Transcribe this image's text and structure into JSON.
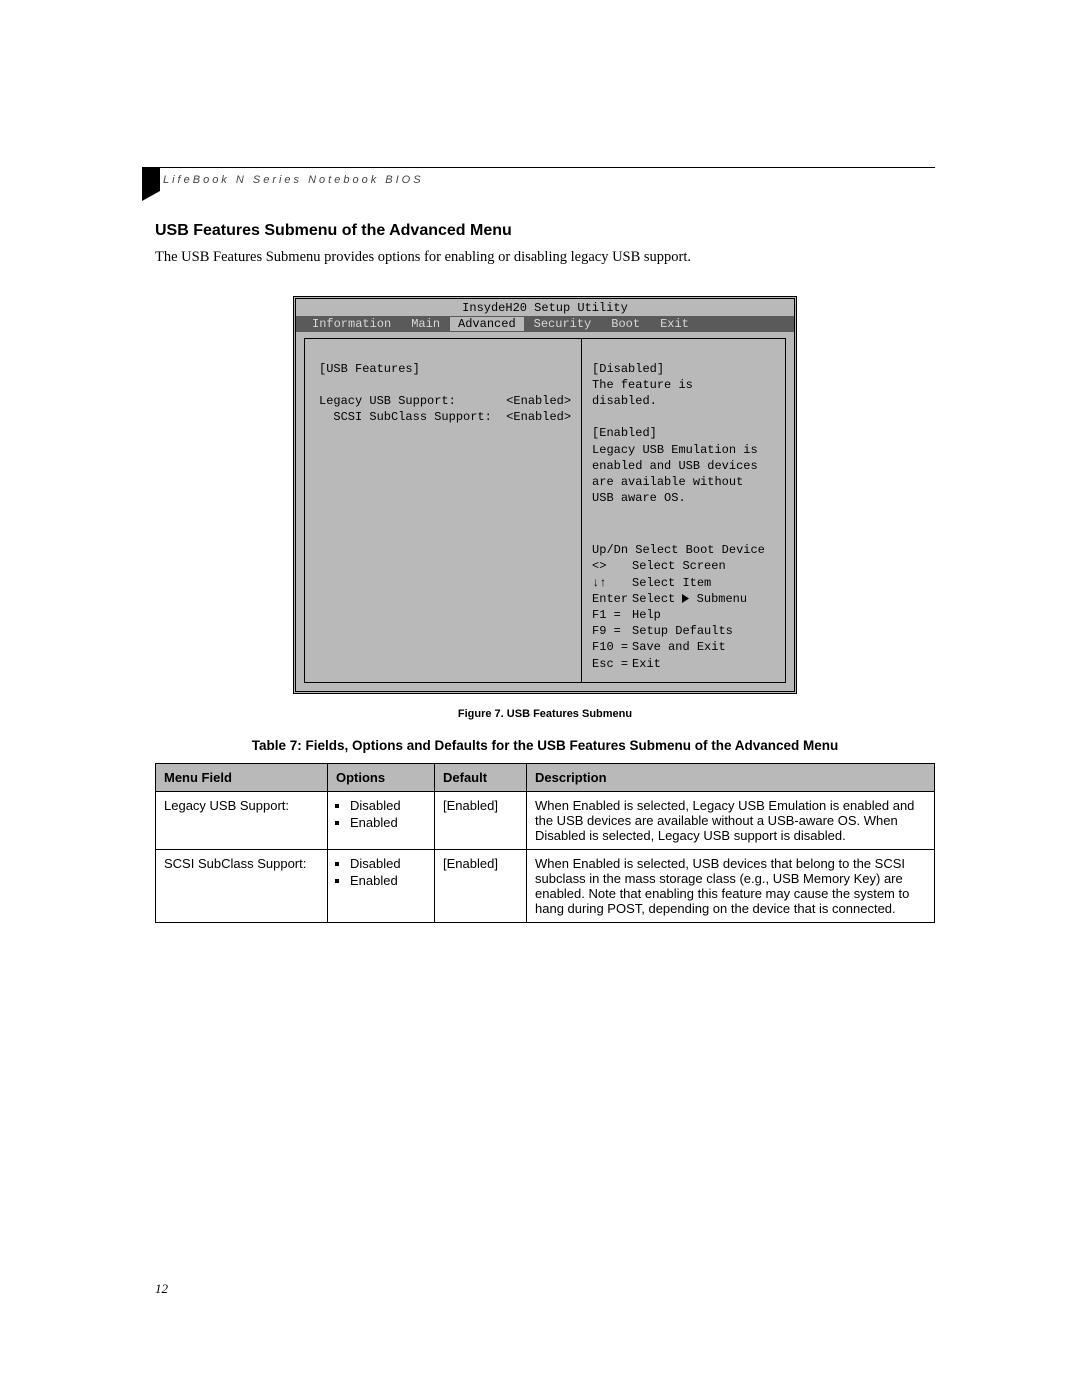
{
  "running_head": "LifeBook N Series Notebook BIOS",
  "section_title": "USB Features Submenu of the Advanced Menu",
  "intro_text": "The USB Features Submenu provides options for enabling or disabling legacy USB support.",
  "bios": {
    "utility_title": "InsydeH20 Setup Utility",
    "menu": {
      "items": [
        "Information",
        "Main",
        "Advanced",
        "Security",
        "Boot",
        "Exit"
      ],
      "selected_index": 2
    },
    "left_panel": {
      "heading": "[USB Features]",
      "rows": [
        {
          "label": "Legacy USB Support:",
          "value": "<Enabled>",
          "indent": 0
        },
        {
          "label": "SCSI SubClass Support:",
          "value": "<Enabled>",
          "indent": 1
        }
      ]
    },
    "right_panel": {
      "description": [
        "[Disabled]",
        "The feature is",
        "disabled.",
        "",
        "[Enabled]",
        "Legacy USB Emulation is",
        "enabled and USB devices",
        "are available without",
        "USB aware OS."
      ],
      "help": [
        {
          "key": "Up/Dn",
          "text": "Select Boot Device",
          "single": true
        },
        {
          "key": "<>",
          "text": "Select Screen"
        },
        {
          "key": "↓↑",
          "text": "Select Item"
        },
        {
          "key": "Enter",
          "text": "Select  Submenu",
          "triangle": true
        },
        {
          "key": "F1  =",
          "text": "Help"
        },
        {
          "key": "F9  =",
          "text": "Setup Defaults"
        },
        {
          "key": "F10 =",
          "text": "Save and Exit"
        },
        {
          "key": "Esc =",
          "text": "Exit"
        }
      ]
    }
  },
  "figure_caption": "Figure 7.  USB Features Submenu",
  "table_title": "Table 7: Fields, Options and Defaults for the USB Features Submenu of the Advanced Menu",
  "fields_table": {
    "headers": [
      "Menu Field",
      "Options",
      "Default",
      "Description"
    ],
    "rows": [
      {
        "menu_field": "Legacy USB Support:",
        "options": [
          "Disabled",
          "Enabled"
        ],
        "default": "[Enabled]",
        "description": "When Enabled is selected, Legacy USB Emulation is enabled and the USB devices are available without a USB-aware OS. When Disabled is selected, Legacy USB support is disabled."
      },
      {
        "menu_field": "SCSI SubClass Support:",
        "options": [
          "Disabled",
          "Enabled"
        ],
        "default": "[Enabled]",
        "description": "When Enabled is selected, USB devices that belong to the SCSI subclass in the mass storage class (e.g., USB Memory Key) are enabled. Note that enabling this feature may cause the system to hang during POST, depending on the device that is connected."
      }
    ]
  },
  "page_number": "12"
}
